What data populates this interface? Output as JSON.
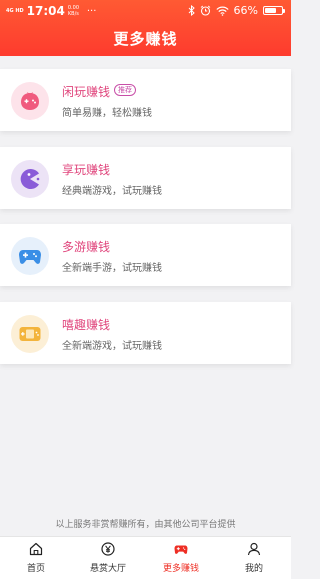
{
  "statusbar": {
    "network": "4G HD",
    "time": "17:04",
    "speed": "0.00 KB/s",
    "more": "···",
    "battery_pct": "66%",
    "battery_level": 0.66
  },
  "header": {
    "title": "更多赚钱"
  },
  "cards": [
    {
      "title": "闲玩赚钱",
      "tag": "推荐",
      "desc": "简单易赚，轻松赚钱",
      "icon": "tomato-gamepad-icon",
      "title_color": "#e0457c",
      "icon_bg": "#fde3ea",
      "icon_color": "#f05a7e"
    },
    {
      "title": "享玩赚钱",
      "desc": "经典端游戏，试玩赚钱",
      "icon": "pacman-icon",
      "title_color": "#e0457c",
      "icon_bg": "#ece3f6",
      "icon_color": "#8a5cd8"
    },
    {
      "title": "多游赚钱",
      "desc": "全新端手游，试玩赚钱",
      "icon": "gamepad-icon",
      "title_color": "#e0457c",
      "icon_bg": "#e6f0fb",
      "icon_color": "#3a8ee6"
    },
    {
      "title": "嘻趣赚钱",
      "desc": "全新端游戏，试玩赚钱",
      "icon": "handheld-game-icon",
      "title_color": "#e0457c",
      "icon_bg": "#fcefd6",
      "icon_color": "#f3b43c"
    }
  ],
  "footer_note": "以上服务非赏帮赚所有，由其他公司平台提供",
  "tabs": [
    {
      "label": "首页",
      "icon": "home-icon"
    },
    {
      "label": "悬赏大厅",
      "icon": "yen-coin-icon"
    },
    {
      "label": "更多赚钱",
      "icon": "gamepad-icon",
      "active": true
    },
    {
      "label": "我的",
      "icon": "user-icon"
    }
  ],
  "colors": {
    "accent": "#fe3b2e",
    "tab_active": "#ee2e24"
  }
}
